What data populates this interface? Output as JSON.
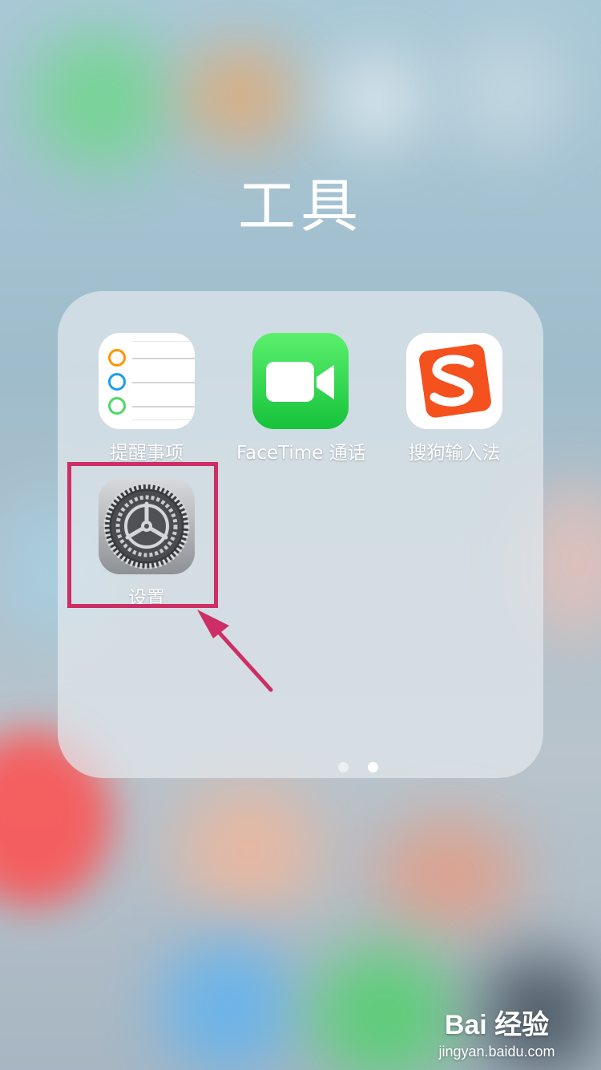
{
  "folder": {
    "title": "工具",
    "apps": [
      {
        "label": "提醒事项",
        "icon": "reminders-icon"
      },
      {
        "label": "FaceTime 通话",
        "icon": "facetime-icon"
      },
      {
        "label": "搜狗输入法",
        "icon": "sogou-input-icon"
      },
      {
        "label": "设置",
        "icon": "settings-gear-icon"
      }
    ],
    "page_count": 2,
    "current_page": 2
  },
  "annotation": {
    "highlight_color": "#cc2e65",
    "target": "设置"
  },
  "watermark": {
    "logo": "Bai 经验",
    "url": "jingyan.baidu.com"
  },
  "colors": {
    "reminder_dots": [
      "#ff9500",
      "#1a9ff2",
      "#4cd964"
    ],
    "facetime_green": "#1ec743",
    "sogou_orange": "#f4511e"
  }
}
